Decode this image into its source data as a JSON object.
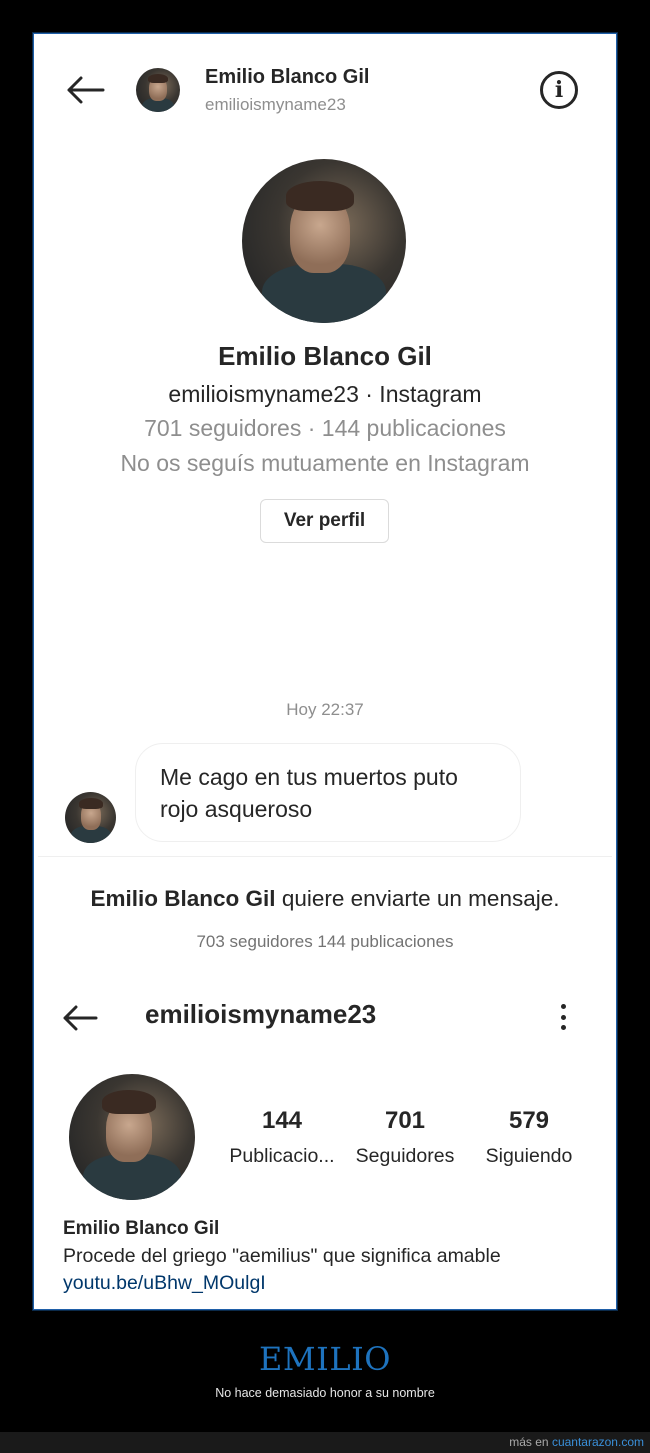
{
  "dm_header": {
    "name": "Emilio Blanco Gil",
    "username": "emilioismyname23",
    "info_glyph": "i"
  },
  "profile_card": {
    "name": "Emilio Blanco Gil",
    "username_source": "emilioismyname23 · Instagram",
    "stats": "701 seguidores · 144 publicaciones",
    "mutual": "No os seguís mutuamente en Instagram",
    "view_profile_label": "Ver perfil"
  },
  "conversation": {
    "timestamp": "Hoy 22:37",
    "messages": [
      {
        "text": "Me cago en tus muertos puto rojo asqueroso"
      }
    ]
  },
  "message_request": {
    "name": "Emilio Blanco Gil",
    "text": " quiere enviarte un mensaje.",
    "stats": "703 seguidores 144 publicaciones"
  },
  "ig_profile": {
    "username": "emilioismyname23",
    "stats": [
      {
        "value": "144",
        "label": "Publicacio..."
      },
      {
        "value": "701",
        "label": "Seguidores"
      },
      {
        "value": "579",
        "label": "Siguiendo"
      }
    ],
    "bio_name": "Emilio Blanco Gil",
    "bio_text": "Procede del griego \"aemilius\" que significa amable",
    "bio_link": "youtu.be/uBhw_MOulgI"
  },
  "caption": {
    "title": "EMILIO",
    "subtitle": "No hace demasiado honor a su nombre"
  },
  "credit": {
    "prefix": "más en ",
    "site": "cuantarazon.com"
  },
  "icons": [
    "back-arrow-icon",
    "info-icon",
    "kebab-menu-icon"
  ],
  "colors": {
    "frame_border": "#1f5fa8",
    "caption_title": "#1e73be",
    "link": "#00376b",
    "muted_text": "#8e8e8e"
  }
}
